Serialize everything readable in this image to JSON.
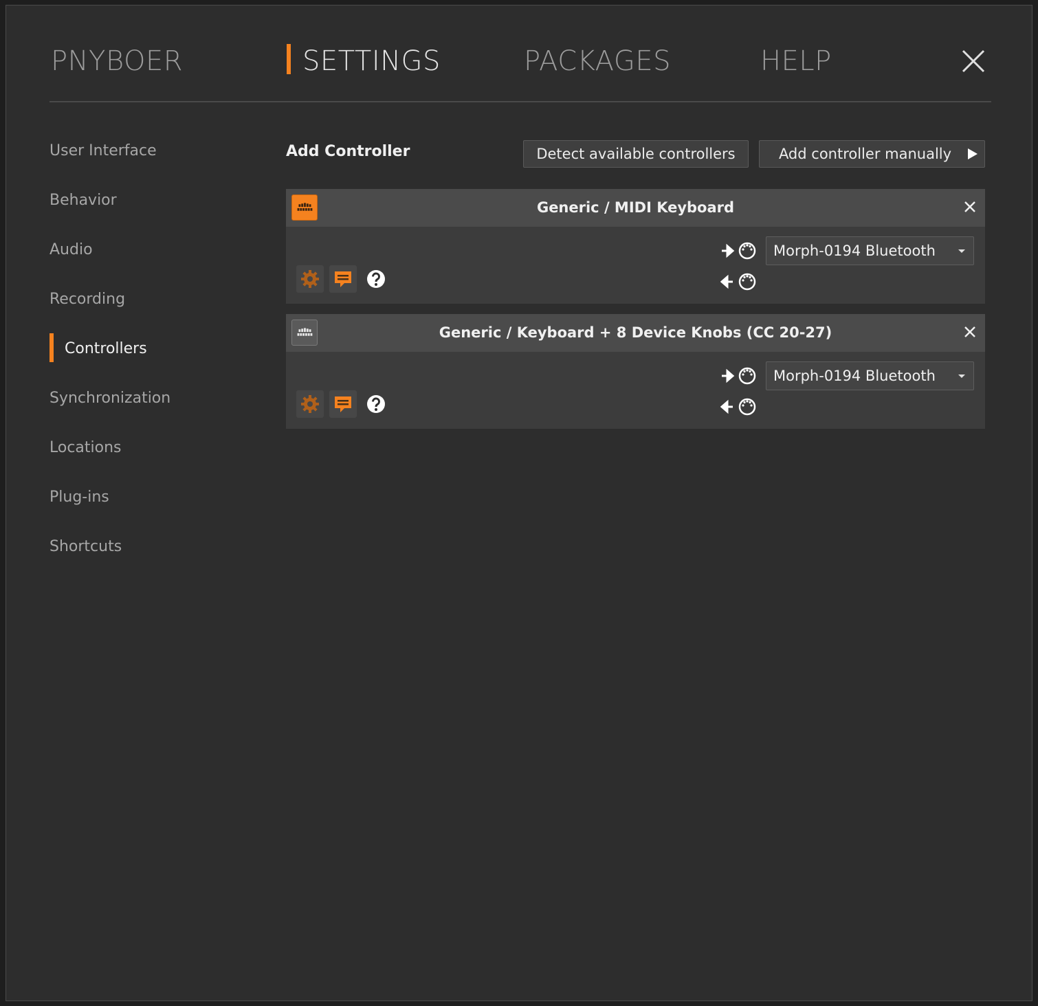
{
  "header": {
    "tabs": [
      {
        "label": "PNYBOER",
        "active": false
      },
      {
        "label": "SETTINGS",
        "active": true
      },
      {
        "label": "PACKAGES",
        "active": false
      },
      {
        "label": "HELP",
        "active": false
      }
    ],
    "close_icon": "close-icon"
  },
  "sidebar": {
    "items": [
      {
        "label": "User Interface",
        "active": false
      },
      {
        "label": "Behavior",
        "active": false
      },
      {
        "label": "Audio",
        "active": false
      },
      {
        "label": "Recording",
        "active": false
      },
      {
        "label": "Controllers",
        "active": true
      },
      {
        "label": "Synchronization",
        "active": false
      },
      {
        "label": "Locations",
        "active": false
      },
      {
        "label": "Plug-ins",
        "active": false
      },
      {
        "label": "Shortcuts",
        "active": false
      }
    ]
  },
  "main": {
    "title": "Add Controller",
    "detect_label": "Detect available controllers",
    "manual_label": "Add controller manually",
    "controllers": [
      {
        "title": "Generic / MIDI Keyboard",
        "enabled": true,
        "input_port": "Morph-0194 Bluetooth"
      },
      {
        "title": "Generic / Keyboard + 8 Device Knobs (CC 20-27)",
        "enabled": false,
        "input_port": "Morph-0194 Bluetooth"
      }
    ]
  },
  "colors": {
    "accent": "#f5821f",
    "background": "#2d2d2d",
    "card": "#3c3c3c",
    "card_header": "#4b4b4b"
  }
}
